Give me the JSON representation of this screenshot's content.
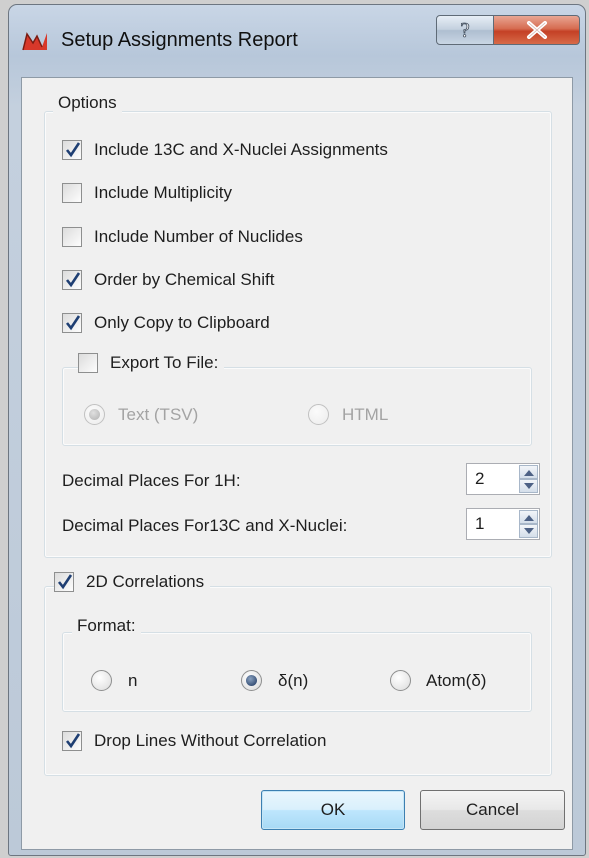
{
  "window": {
    "title": "Setup Assignments Report",
    "help_glyph": "?",
    "close_glyph": "X"
  },
  "options": {
    "group_title": "Options",
    "include_13c": {
      "label": "Include 13C and X-Nuclei Assignments",
      "checked": true
    },
    "include_multiplicity": {
      "label": "Include Multiplicity",
      "checked": false
    },
    "include_nuclides": {
      "label": "Include Number of Nuclides",
      "checked": false
    },
    "order_by_shift": {
      "label": "Order by Chemical Shift",
      "checked": true
    },
    "only_clipboard": {
      "label": "Only Copy to Clipboard",
      "checked": true
    },
    "export_to_file": {
      "label": "Export To File:",
      "checked": false,
      "text_tsv": {
        "label": "Text (TSV)",
        "selected": true,
        "enabled": false
      },
      "html": {
        "label": "HTML",
        "selected": false,
        "enabled": false
      }
    },
    "decimal_1h": {
      "label": "Decimal Places For 1H:",
      "value": "2"
    },
    "decimal_13c": {
      "label": "Decimal Places For13C and X-Nuclei:",
      "value": "1"
    }
  },
  "correlations": {
    "label": "2D Correlations",
    "checked": true,
    "format": {
      "group_title": "Format:",
      "options": [
        {
          "label": "n",
          "selected": false
        },
        {
          "label": "δ(n)",
          "selected": true
        },
        {
          "label": "Atom(δ)",
          "selected": false
        }
      ]
    },
    "drop_lines": {
      "label": "Drop Lines Without Correlation",
      "checked": true
    }
  },
  "buttons": {
    "ok": "OK",
    "cancel": "Cancel"
  },
  "colors": {
    "accent_check": "#1f3f73",
    "title_bar": "#bcc9d8",
    "close_button": "#c44025",
    "default_button_border": "#3c7fb1"
  }
}
